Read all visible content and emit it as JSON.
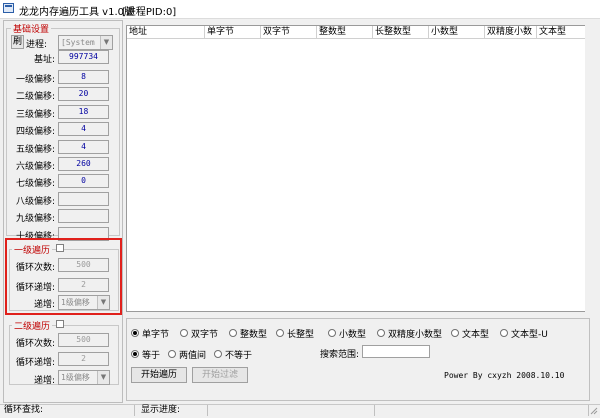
{
  "window": {
    "title": "龙龙内存遍历工具 v1.0版",
    "pid_label": "[进程PID:0]"
  },
  "basic": {
    "group_title": "基础设置",
    "refresh_label": "刷",
    "process_label": "进程:",
    "process_value": "[System Pr",
    "base_label": "基址:",
    "base_value": "997734",
    "offsets": [
      {
        "label": "一级偏移:",
        "value": "8"
      },
      {
        "label": "二级偏移:",
        "value": "20"
      },
      {
        "label": "三级偏移:",
        "value": "18"
      },
      {
        "label": "四级偏移:",
        "value": "4"
      },
      {
        "label": "五级偏移:",
        "value": "4"
      },
      {
        "label": "六级偏移:",
        "value": "260"
      },
      {
        "label": "七级偏移:",
        "value": "0"
      },
      {
        "label": "八级偏移:",
        "value": ""
      },
      {
        "label": "九级偏移:",
        "value": ""
      },
      {
        "label": "十级偏移:",
        "value": ""
      }
    ]
  },
  "level1": {
    "group_title": "一级遍历",
    "loop_label": "循环次数:",
    "loop_value": "500",
    "step_label": "循环递增:",
    "step_value": "2",
    "by_label": "递增:",
    "by_value": "1级偏移"
  },
  "level2": {
    "group_title": "二级遍历",
    "loop_label": "循环次数:",
    "loop_value": "500",
    "step_label": "循环递增:",
    "step_value": "2",
    "by_label": "递增:",
    "by_value": "1级偏移"
  },
  "list": {
    "columns": [
      "地址",
      "单字节",
      "双字节",
      "整数型",
      "长整数型",
      "小数型",
      "双精度小数",
      "文本型"
    ]
  },
  "options": {
    "types": [
      "单字节",
      "双字节",
      "整数型",
      "长整型",
      "小数型",
      "双精度小数型",
      "文本型",
      "文本型-U"
    ],
    "selected_type": 0,
    "compares": [
      "等于",
      "两值间",
      "不等于"
    ],
    "selected_compare": 0,
    "range_label": "搜索范围:",
    "range_value": "",
    "start_button": "开始遍历",
    "filter_button": "开始过滤",
    "credit": "Power By cxyzh 2008.10.10"
  },
  "statusbar": {
    "loop_search": "循环查找:",
    "progress": "显示进度:"
  }
}
